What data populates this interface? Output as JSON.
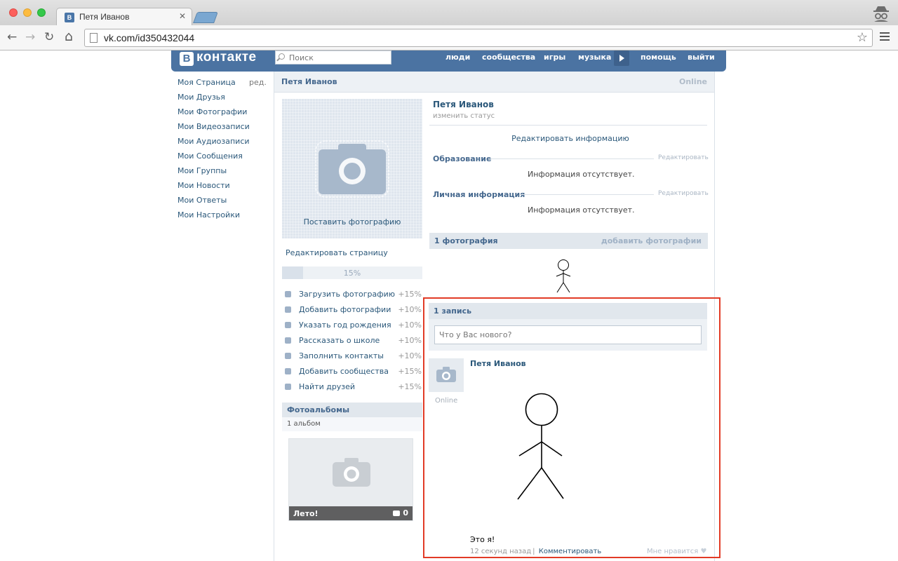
{
  "browser": {
    "tab_title": "Петя Иванов",
    "tab_favicon": "В",
    "tab_close": "✕",
    "url": "vk.com/id350432044",
    "back": "←",
    "forward": "→",
    "reload": "↻",
    "home": "⌂",
    "bookmark_star": "☆"
  },
  "vk": {
    "logo_mark": "В",
    "logo_text": "контакте",
    "search_placeholder": "Поиск",
    "nav": [
      "люди",
      "сообщества",
      "игры",
      "музыка",
      "помощь",
      "выйти"
    ]
  },
  "left_menu": {
    "items": [
      "Моя Страница",
      "Мои Друзья",
      "Мои Фотографии",
      "Мои Видеозаписи",
      "Мои Аудиозаписи",
      "Мои Сообщения",
      "Мои Группы",
      "Мои Новости",
      "Мои Ответы",
      "Мои Настройки"
    ],
    "edit": "ред."
  },
  "profile": {
    "bar_name": "Петя Иванов",
    "bar_status": "Online",
    "avatar_caption": "Поставить фотографию",
    "edit_page": "Редактировать страницу",
    "progress_text": "15%",
    "progress_value": 0.15,
    "tasks": [
      {
        "label": "Загрузить фотографию",
        "pct": "+15%",
        "icon": "person-icon"
      },
      {
        "label": "Добавить фотографии",
        "pct": "+10%",
        "icon": "camera-icon"
      },
      {
        "label": "Указать год рождения",
        "pct": "+10%",
        "icon": "gift-icon"
      },
      {
        "label": "Рассказать о школе",
        "pct": "+10%",
        "icon": "briefcase-icon"
      },
      {
        "label": "Заполнить контакты",
        "pct": "+10%",
        "icon": "phone-icon"
      },
      {
        "label": "Добавить сообщества",
        "pct": "+15%",
        "icon": "star-icon"
      },
      {
        "label": "Найти друзей",
        "pct": "+15%",
        "icon": "friends-icon"
      }
    ],
    "albums_title": "Фотоальбомы",
    "albums_count": "1 альбом",
    "album_name": "Лето!",
    "album_photos": "0",
    "name": "Петя Иванов",
    "change_status": "изменить статус",
    "edit_info": "Редактировать информацию",
    "education_title": "Образование",
    "personal_title": "Личная информация",
    "section_edit": "Редактировать",
    "no_info": "Информация отсутствует.",
    "photos_title": "1 фотография",
    "add_photos": "добавить фотографии"
  },
  "wall": {
    "title": "1 запись",
    "compose_placeholder": "Что у Вас нового?",
    "post_author": "Петя Иванов",
    "post_author_status": "Online",
    "post_text": "Это я!",
    "post_time": "12 секунд назад",
    "post_comment": "Комментировать",
    "post_like": "Мне нравится",
    "highlight_color": "#e23b26"
  }
}
